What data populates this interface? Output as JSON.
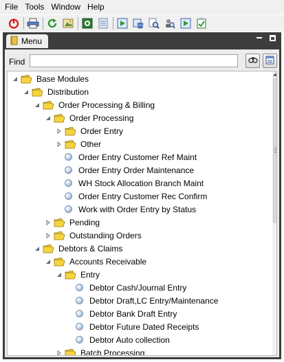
{
  "menubar": {
    "items": [
      "File",
      "Tools",
      "Window",
      "Help"
    ]
  },
  "toolbar": {
    "icons": [
      "power-icon",
      "print-icon",
      "refresh-icon",
      "image-icon",
      "capture-icon",
      "notes-icon",
      "run-program-icon",
      "database-icon",
      "search-document-icon",
      "users-search-icon",
      "run-job-icon",
      "checklist-icon"
    ]
  },
  "tab": {
    "label": "Menu",
    "icon": "book-icon"
  },
  "find": {
    "label": "Find",
    "value": "",
    "placeholder": ""
  },
  "colors": {
    "frame": "#3d3d3d",
    "panel": "#ececec",
    "folder": "#f5d53f",
    "leaf": "#8aa5c8"
  },
  "tree": [
    {
      "label": "Base Modules",
      "level": 0,
      "kind": "folder",
      "expanded": true
    },
    {
      "label": "Distribution",
      "level": 1,
      "kind": "folder",
      "expanded": true
    },
    {
      "label": "Order Processing & Billing",
      "level": 2,
      "kind": "folder",
      "expanded": true
    },
    {
      "label": "Order Processing",
      "level": 3,
      "kind": "folder",
      "expanded": true
    },
    {
      "label": "Order Entry",
      "level": 4,
      "kind": "folder",
      "expanded": false
    },
    {
      "label": "Other",
      "level": 4,
      "kind": "folder",
      "expanded": false
    },
    {
      "label": "Order Entry Customer Ref Maint",
      "level": 4,
      "kind": "leaf"
    },
    {
      "label": "Order Entry Order Maintenance",
      "level": 4,
      "kind": "leaf"
    },
    {
      "label": "WH Stock Allocation Branch Maint",
      "level": 4,
      "kind": "leaf"
    },
    {
      "label": "Order Entry Customer Rec Confirm",
      "level": 4,
      "kind": "leaf"
    },
    {
      "label": "Work with Order Entry by Status",
      "level": 4,
      "kind": "leaf"
    },
    {
      "label": "Pending",
      "level": 3,
      "kind": "folder",
      "expanded": false
    },
    {
      "label": "Outstanding Orders",
      "level": 3,
      "kind": "folder",
      "expanded": false
    },
    {
      "label": "Debtors & Claims",
      "level": 2,
      "kind": "folder",
      "expanded": true
    },
    {
      "label": "Accounts Receivable",
      "level": 3,
      "kind": "folder",
      "expanded": true
    },
    {
      "label": "Entry",
      "level": 4,
      "kind": "folder",
      "expanded": true
    },
    {
      "label": "Debtor Cash/Journal Entry",
      "level": 5,
      "kind": "leaf"
    },
    {
      "label": "Debtor Draft,LC Entry/Maintenance",
      "level": 5,
      "kind": "leaf"
    },
    {
      "label": "Debtor Bank Draft Entry",
      "level": 5,
      "kind": "leaf"
    },
    {
      "label": "Debtor Future Dated Receipts",
      "level": 5,
      "kind": "leaf"
    },
    {
      "label": "Debtor Auto collection",
      "level": 5,
      "kind": "leaf"
    },
    {
      "label": "Batch Processing",
      "level": 4,
      "kind": "folder",
      "expanded": false
    }
  ]
}
